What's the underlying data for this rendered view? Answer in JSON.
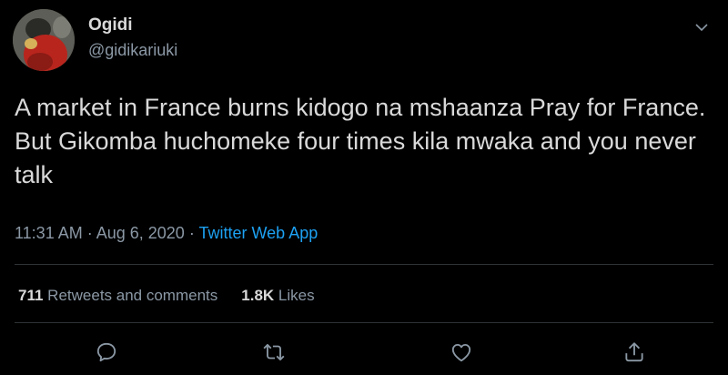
{
  "user": {
    "display_name": "Ogidi",
    "handle": "@gidikariuki"
  },
  "tweet": {
    "text": "A market in France burns kidogo na mshaanza Pray for France. But Gikomba huchomeke four times kila mwaka and you never talk",
    "time": "11:31 AM",
    "separator": " · ",
    "date": "Aug 6, 2020",
    "source": "Twitter Web App"
  },
  "stats": {
    "retweets_count": "711",
    "retweets_label": "Retweets and comments",
    "likes_count": "1.8K",
    "likes_label": "Likes"
  },
  "icons": {
    "menu": "chevron-down-icon",
    "reply": "comment-icon",
    "retweet": "retweet-icon",
    "like": "heart-icon",
    "share": "share-icon"
  },
  "colors": {
    "background": "#000000",
    "text": "#d9d9d9",
    "muted": "#8b98a5",
    "link": "#1da1f2",
    "divider": "#2f3336"
  }
}
